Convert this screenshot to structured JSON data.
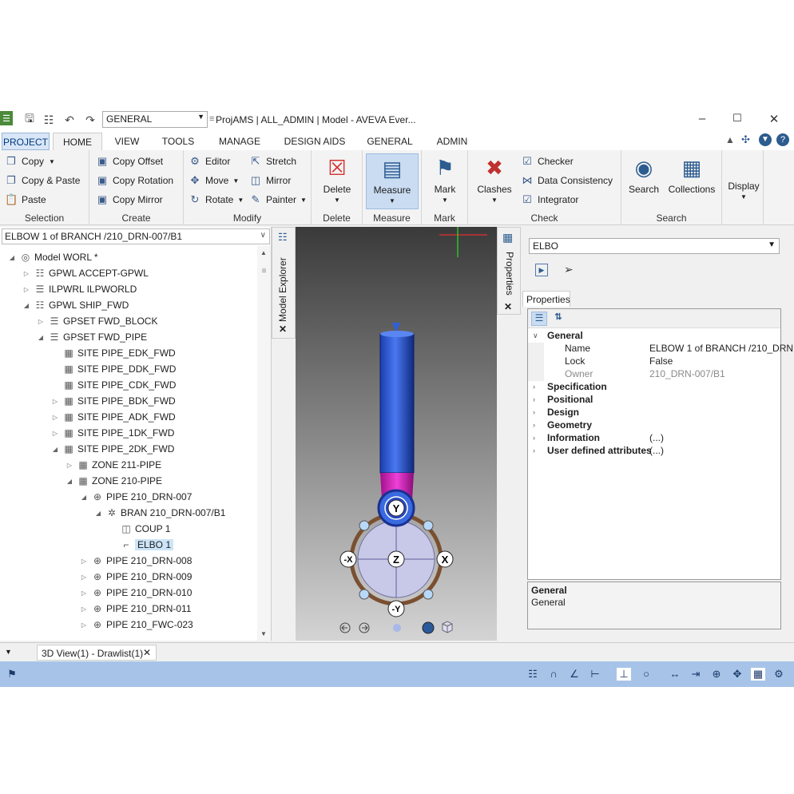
{
  "qat": {
    "combo_value": "GENERAL",
    "title": "ProjAMS | ALL_ADMIN | Model - AVEVA Ever..."
  },
  "tabs": [
    "PROJECT",
    "HOME",
    "VIEW",
    "TOOLS",
    "MANAGE",
    "DESIGN AIDS",
    "GENERAL",
    "ADMIN"
  ],
  "ribbon": {
    "selection": {
      "items": [
        "Copy",
        "Copy & Paste",
        "Paste"
      ],
      "label": "Selection"
    },
    "create": {
      "items": [
        "Copy Offset",
        "Copy Rotation",
        "Copy Mirror"
      ],
      "label": "Create"
    },
    "modify": {
      "items": [
        "Editor",
        "Stretch",
        "Move",
        "Mirror",
        "Rotate",
        "Painter"
      ],
      "label": "Modify"
    },
    "delete": {
      "button": "Delete",
      "label": "Delete"
    },
    "measure": {
      "button": "Measure",
      "label": "Measure"
    },
    "mark": {
      "button": "Mark",
      "label": "Mark"
    },
    "check": {
      "clashes": "Clashes",
      "items": [
        "Checker",
        "Data Consistency",
        "Integrator"
      ],
      "label": "Check"
    },
    "search": {
      "items": [
        "Search",
        "Collections"
      ],
      "label": "Search"
    },
    "display": {
      "button": "Display"
    }
  },
  "explorer": {
    "combo": "ELBOW 1 of BRANCH /210_DRN-007/B1",
    "tab_label": "Model Explorer",
    "nodes": [
      {
        "label": "Model WORL *",
        "depth": 0,
        "exp": "open",
        "icon": "globe-icon"
      },
      {
        "label": "GPWL ACCEPT-GPWL",
        "depth": 1,
        "exp": "closed",
        "icon": "group-icon"
      },
      {
        "label": "ILPWRL ILPWORLD",
        "depth": 1,
        "exp": "closed",
        "icon": "tree-icon"
      },
      {
        "label": "GPWL SHIP_FWD",
        "depth": 1,
        "exp": "open",
        "icon": "group-icon"
      },
      {
        "label": "GPSET FWD_BLOCK",
        "depth": 2,
        "exp": "closed",
        "icon": "tree-icon"
      },
      {
        "label": "GPSET FWD_PIPE",
        "depth": 2,
        "exp": "open",
        "icon": "tree-icon"
      },
      {
        "label": "SITE PIPE_EDK_FWD",
        "depth": 3,
        "exp": "",
        "icon": "site-icon"
      },
      {
        "label": "SITE PIPE_DDK_FWD",
        "depth": 3,
        "exp": "",
        "icon": "site-icon"
      },
      {
        "label": "SITE PIPE_CDK_FWD",
        "depth": 3,
        "exp": "",
        "icon": "site-icon"
      },
      {
        "label": "SITE PIPE_BDK_FWD",
        "depth": 3,
        "exp": "closed",
        "icon": "site-icon"
      },
      {
        "label": "SITE PIPE_ADK_FWD",
        "depth": 3,
        "exp": "closed",
        "icon": "site-icon"
      },
      {
        "label": "SITE PIPE_1DK_FWD",
        "depth": 3,
        "exp": "closed",
        "icon": "site-icon"
      },
      {
        "label": "SITE PIPE_2DK_FWD",
        "depth": 3,
        "exp": "open",
        "icon": "site-icon"
      },
      {
        "label": "ZONE 211-PIPE",
        "depth": 4,
        "exp": "closed",
        "icon": "zone-icon"
      },
      {
        "label": "ZONE 210-PIPE",
        "depth": 4,
        "exp": "open",
        "icon": "zone-icon"
      },
      {
        "label": "PIPE 210_DRN-007",
        "depth": 5,
        "exp": "open",
        "icon": "pipe-icon"
      },
      {
        "label": "BRAN 210_DRN-007/B1",
        "depth": 6,
        "exp": "open",
        "icon": "branch-icon"
      },
      {
        "label": "COUP 1",
        "depth": 7,
        "exp": "",
        "icon": "coupling-icon"
      },
      {
        "label": "ELBO 1",
        "depth": 7,
        "exp": "",
        "icon": "elbow-icon",
        "selected": true
      },
      {
        "label": "PIPE 210_DRN-008",
        "depth": 5,
        "exp": "closed",
        "icon": "pipe-icon"
      },
      {
        "label": "PIPE 210_DRN-009",
        "depth": 5,
        "exp": "closed",
        "icon": "pipe-icon"
      },
      {
        "label": "PIPE 210_DRN-010",
        "depth": 5,
        "exp": "closed",
        "icon": "pipe-icon"
      },
      {
        "label": "PIPE 210_DRN-011",
        "depth": 5,
        "exp": "closed",
        "icon": "pipe-icon"
      },
      {
        "label": "PIPE 210_FWC-023",
        "depth": 5,
        "exp": "closed",
        "icon": "pipe-icon"
      }
    ]
  },
  "viewport": {
    "handles": [
      "Y",
      "-X",
      "Z",
      "X",
      "-Y"
    ]
  },
  "properties": {
    "tab_label": "Properties",
    "combo": "ELBO",
    "subtab": "Properties",
    "rows": [
      {
        "key": "General",
        "value": "",
        "type": "cat-open"
      },
      {
        "key": "Name",
        "value": "ELBOW 1 of BRANCH /210_DRN",
        "type": "prop"
      },
      {
        "key": "Lock",
        "value": "False",
        "type": "prop"
      },
      {
        "key": "Owner",
        "value": "210_DRN-007/B1",
        "type": "prop-grey"
      },
      {
        "key": "Specification",
        "value": "",
        "type": "cat"
      },
      {
        "key": "Positional",
        "value": "",
        "type": "cat"
      },
      {
        "key": "Design",
        "value": "",
        "type": "cat"
      },
      {
        "key": "Geometry",
        "value": "",
        "type": "cat"
      },
      {
        "key": "Information",
        "value": "(...)",
        "type": "cat"
      },
      {
        "key": "User defined attributes",
        "value": "(...)",
        "type": "cat"
      }
    ],
    "desc_title": "General",
    "desc_text": "General"
  },
  "doc_tab": "3D View(1) - Drawlist(1)"
}
